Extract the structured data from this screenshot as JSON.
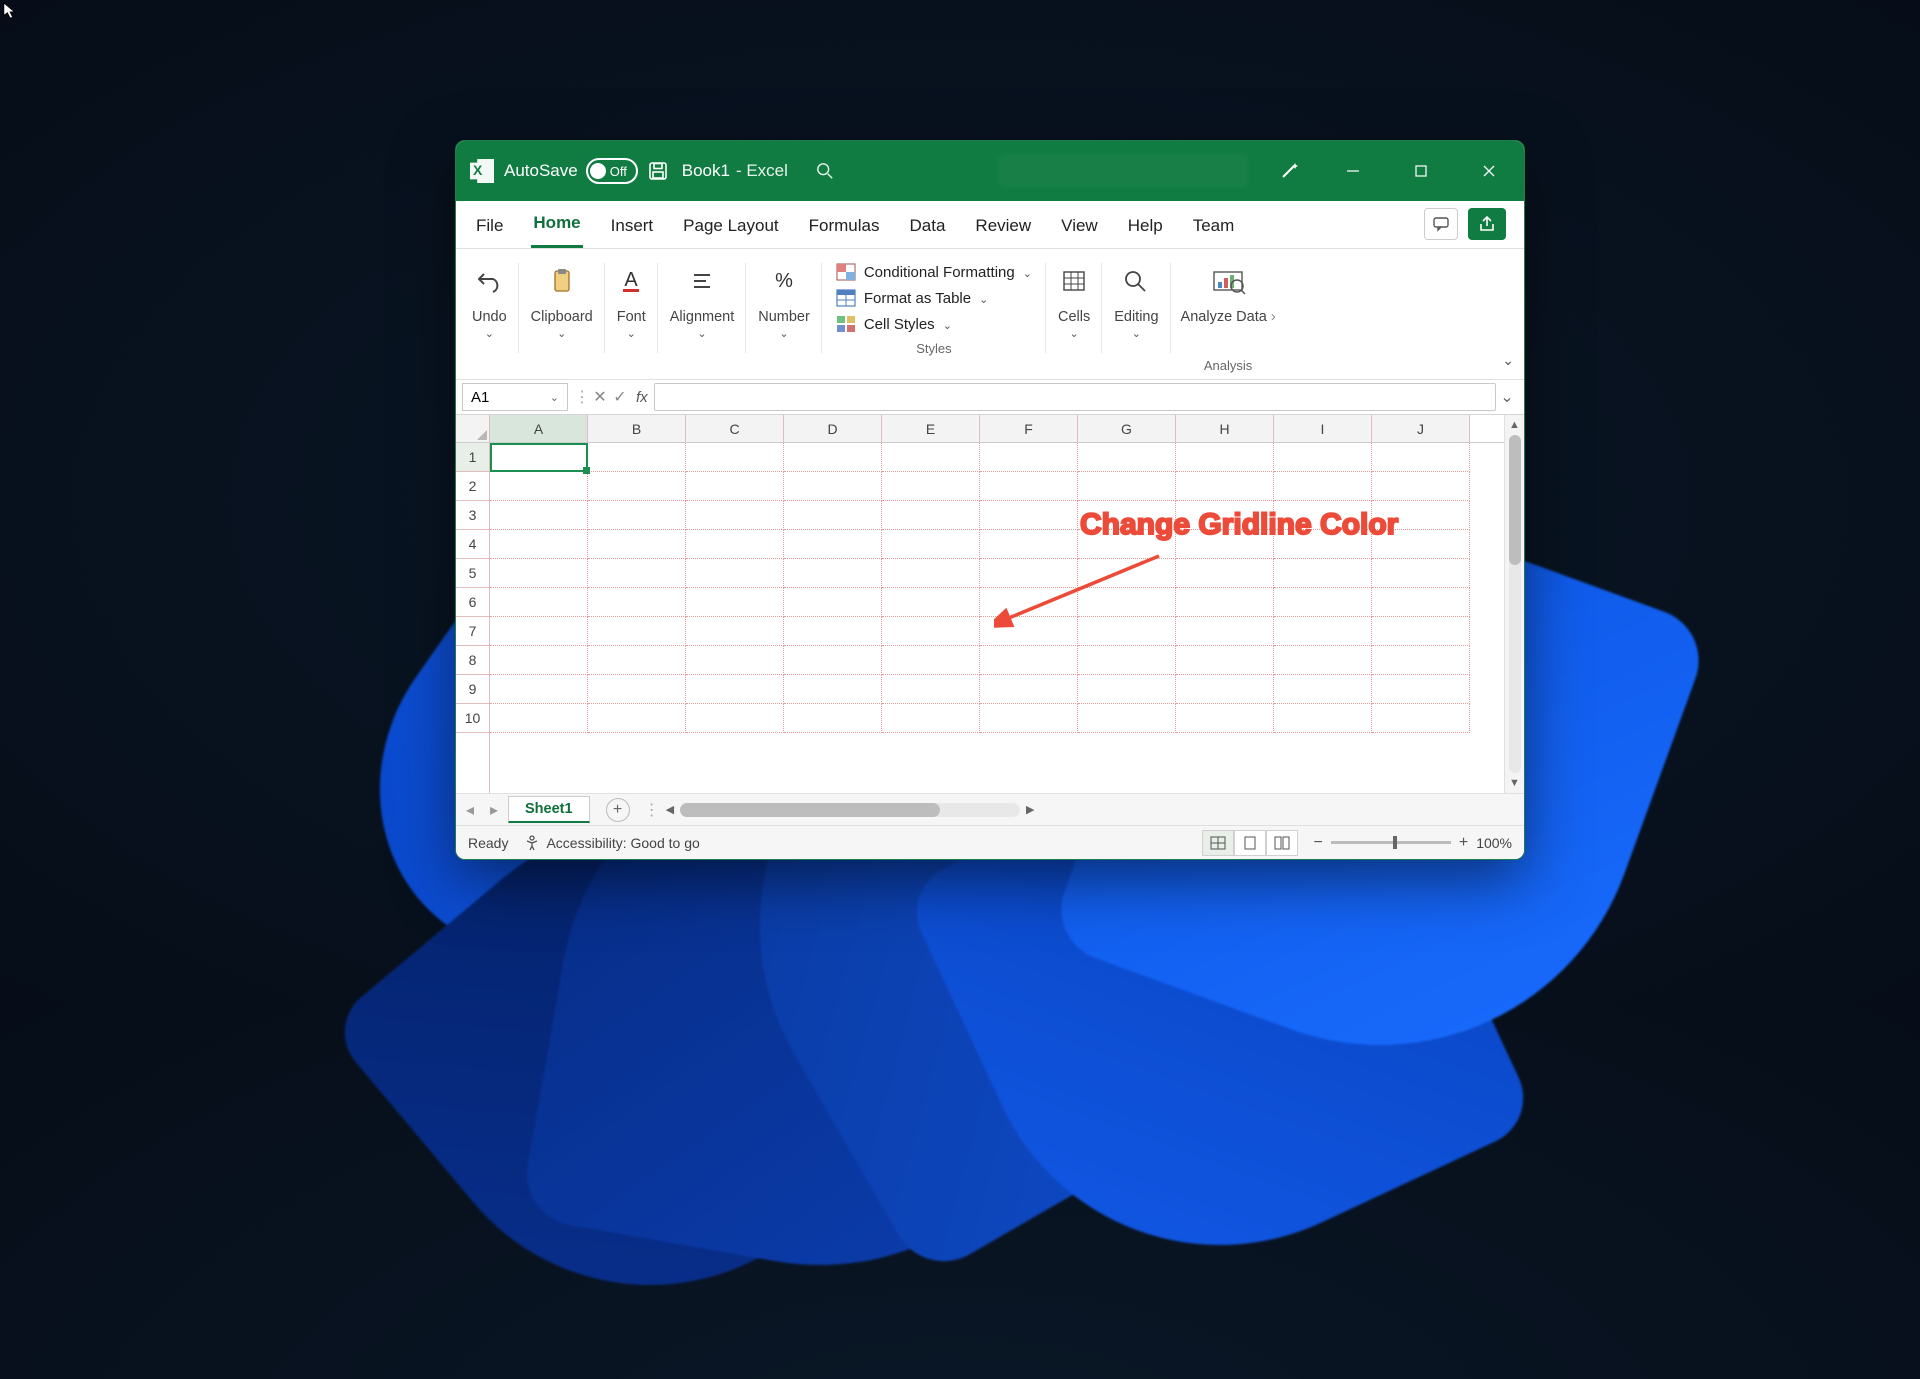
{
  "titlebar": {
    "autosave_label": "AutoSave",
    "autosave_state": "Off",
    "doc_name": "Book1",
    "app_suffix": "-  Excel"
  },
  "tabs": {
    "file": "File",
    "home": "Home",
    "insert": "Insert",
    "page_layout": "Page Layout",
    "formulas": "Formulas",
    "data": "Data",
    "review": "Review",
    "view": "View",
    "help": "Help",
    "team": "Team"
  },
  "ribbon": {
    "undo": "Undo",
    "clipboard": "Clipboard",
    "font": "Font",
    "alignment": "Alignment",
    "number": "Number",
    "cond_fmt": "Conditional Formatting",
    "fmt_table": "Format as Table",
    "cell_styles": "Cell Styles",
    "styles_group": "Styles",
    "cells": "Cells",
    "editing": "Editing",
    "analyze_data": "Analyze Data",
    "analysis_group": "Analysis"
  },
  "formula_bar": {
    "namebox": "A1"
  },
  "columns": [
    "A",
    "B",
    "C",
    "D",
    "E",
    "F",
    "G",
    "H",
    "I",
    "J"
  ],
  "rows": [
    "1",
    "2",
    "3",
    "4",
    "5",
    "6",
    "7",
    "8",
    "9",
    "10"
  ],
  "sheet_tabs": {
    "sheet1": "Sheet1"
  },
  "statusbar": {
    "ready": "Ready",
    "accessibility": "Accessibility: Good to go",
    "zoom": "100%"
  },
  "annotation": {
    "text": "Change Gridline Color"
  }
}
